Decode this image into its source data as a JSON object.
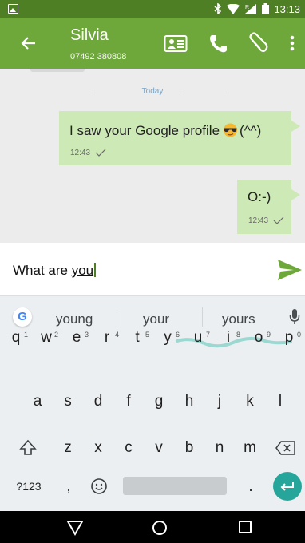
{
  "status_bar": {
    "time": "13:13",
    "icons": [
      "image-notification-icon",
      "bluetooth-icon",
      "wifi-icon",
      "signal-icon",
      "battery-icon"
    ],
    "signal_label": "R"
  },
  "app_bar": {
    "contact_name": "Silvia",
    "contact_phone": "07492 380808",
    "icons": [
      "back-arrow-icon",
      "contact-card-icon",
      "phone-icon",
      "paperclip-icon",
      "more-vert-icon"
    ],
    "color": "#6ea73a",
    "status_color": "#4f7f24"
  },
  "chat": {
    "date_separator": "Today",
    "messages": [
      {
        "text": "I saw your Google profile",
        "trailing": "(^^)",
        "emoji": "sunglasses-face",
        "time": "12:43",
        "status": "sent"
      },
      {
        "text": "O:-)",
        "time": "12:43",
        "status": "sent"
      }
    ],
    "bubble_color": "#cde9b5"
  },
  "compose": {
    "text_before": "What are ",
    "text_current_word": "you",
    "send_icon": "send-icon",
    "send_color": "#6ea73a"
  },
  "keyboard": {
    "suggestions": [
      "young",
      "your",
      "yours"
    ],
    "row1": [
      {
        "key": "q",
        "hint": "1"
      },
      {
        "key": "w",
        "hint": "2"
      },
      {
        "key": "e",
        "hint": "3"
      },
      {
        "key": "r",
        "hint": "4"
      },
      {
        "key": "t",
        "hint": "5"
      },
      {
        "key": "y",
        "hint": "6"
      },
      {
        "key": "u",
        "hint": "7"
      },
      {
        "key": "i",
        "hint": "8"
      },
      {
        "key": "o",
        "hint": "9"
      },
      {
        "key": "p",
        "hint": "0"
      }
    ],
    "row2": [
      "a",
      "s",
      "d",
      "f",
      "g",
      "h",
      "j",
      "k",
      "l"
    ],
    "row3": [
      "z",
      "x",
      "c",
      "v",
      "b",
      "n",
      "m"
    ],
    "symbols_key": "?123",
    "comma_key": ",",
    "period_key": ".",
    "enter_color": "#26a69a"
  },
  "nav_bar": {
    "icons": [
      "nav-back-icon",
      "nav-home-icon",
      "nav-recents-icon"
    ]
  }
}
